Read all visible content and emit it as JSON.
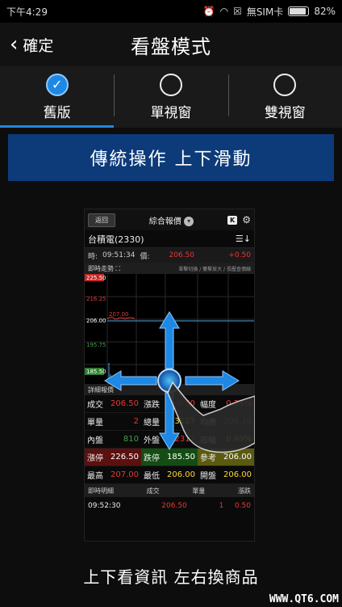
{
  "status": {
    "time": "下午4:29",
    "carrier": "無SIM卡",
    "battery": "82%"
  },
  "header": {
    "back_label": "確定",
    "title": "看盤模式"
  },
  "tabs": [
    {
      "label": "舊版",
      "checked": true
    },
    {
      "label": "單視窗",
      "checked": false
    },
    {
      "label": "雙視窗",
      "checked": false
    }
  ],
  "banner": "傳統操作 上下滑動",
  "preview": {
    "back_btn": "返回",
    "title": "綜合報價",
    "k_btn": "K",
    "stock": "台積電(2330)",
    "quote": {
      "time_label": "時:",
      "time": "09:51:34",
      "price_label": "價:",
      "price": "206.50",
      "change": "+0.50"
    },
    "chart_section": "即時走勢",
    "chart_hint": "單擊切換 / 雙擊放大 / 長壓查價線",
    "y_labels": [
      "225.50",
      "216.25",
      "207.00",
      "206.00",
      "195.75",
      "185.50"
    ],
    "x_labels": [
      "09",
      "10",
      "12",
      "13"
    ],
    "detail_section": "詳細報價",
    "rows": [
      [
        {
          "l": "成交",
          "v": "206.50"
        },
        {
          "l": "漲跌",
          "v": "+0.50"
        },
        {
          "l": "幅度",
          "v": "0.24%"
        }
      ],
      [
        {
          "l": "單量",
          "v": "2"
        },
        {
          "l": "總量",
          "v": "3127"
        },
        {
          "l": "均價",
          "v": "205.16"
        }
      ],
      [
        {
          "l": "內盤",
          "v": "810"
        },
        {
          "l": "外盤",
          "v": "2317"
        },
        {
          "l": "振幅",
          "v": "0.49%"
        }
      ],
      [
        {
          "l": "漲停",
          "v": "226.50"
        },
        {
          "l": "跌停",
          "v": "185.50"
        },
        {
          "l": "參考",
          "v": "206.00"
        }
      ],
      [
        {
          "l": "最高",
          "v": "207.00"
        },
        {
          "l": "最低",
          "v": "206.00"
        },
        {
          "l": "開盤",
          "v": "206.00"
        }
      ]
    ],
    "ticks_header": {
      "title": "即時明細",
      "c1": "成交",
      "c2": "單量",
      "c3": "漲跌"
    },
    "tick": {
      "time": "09:52:30",
      "price": "206.50",
      "qty": "1",
      "chg": "0.50"
    }
  },
  "caption": "上下看資訊 左右換商品",
  "watermark": "WWW.QT6.COM",
  "colors": {
    "accent": "#1e88e5",
    "banner": "#0d3b7a",
    "up": "#e53935",
    "down": "#43a047"
  }
}
